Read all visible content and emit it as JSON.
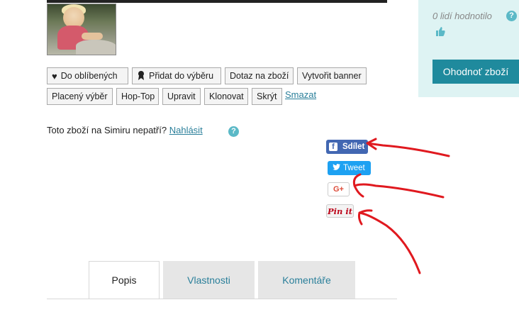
{
  "actions": {
    "favorite": "Do oblíbených",
    "add_to_selection": "Přidat do výběru",
    "ask_question": "Dotaz na zboží",
    "create_banner": "Vytvořit banner",
    "paid_selection": "Placený výběr",
    "hop_top": "Hop-Top",
    "edit": "Upravit",
    "clone": "Klonovat",
    "hide": "Skrýt",
    "delete": "Smazat"
  },
  "report": {
    "text": "Toto zboží na Simiru nepatří?",
    "link": "Nahlásit",
    "help": "?"
  },
  "sidebar": {
    "rating_text": "0 lidí hodnotilo",
    "help": "?",
    "rate_button": "Ohodnoť zboží"
  },
  "share": {
    "facebook": "Sdílet",
    "facebook_glyph": "f",
    "twitter": "Tweet",
    "google_plus": "G+",
    "pinterest": "Pin it"
  },
  "tabs": [
    "Popis",
    "Vlastnosti",
    "Komentáře"
  ],
  "icons": [
    "heart-icon",
    "award-icon",
    "thumbs-up-icon",
    "help-icon",
    "twitter-bird-icon"
  ],
  "colors": {
    "accent": "#1f8a9d",
    "link": "#2a7f9a",
    "sidebar_bg": "#def3f3",
    "facebook": "#4267b2",
    "twitter": "#1da1f2",
    "annotation": "#e0191f"
  }
}
